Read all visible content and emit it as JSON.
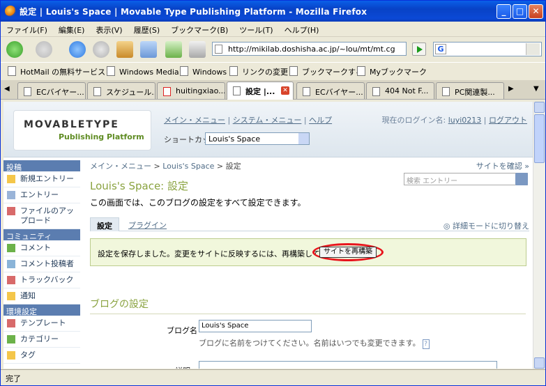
{
  "window": {
    "title": "設定 | Louis's Space | Movable Type Publishing Platform - Mozilla Firefox"
  },
  "menubar": [
    "ファイル(F)",
    "編集(E)",
    "表示(V)",
    "履歴(S)",
    "ブックマーク(B)",
    "ツール(T)",
    "ヘルプ(H)"
  ],
  "navbar": {
    "url": "http://mikilab.doshisha.ac.jp/~lou/mt/mt.cgi?_",
    "search_value": ""
  },
  "bookmarks": [
    "HotMail の無料サービス",
    "Windows Media",
    "Windows",
    "リンクの変更",
    "ブックマークする",
    "Myブックマーク"
  ],
  "tabs": [
    "ECバイヤー...",
    "スケジュール...",
    "huitingxiao...",
    "設定 |...",
    "ECバイヤー...",
    "404 Not F...",
    "PC関連製..."
  ],
  "statusbar": {
    "text": "完了"
  },
  "mt": {
    "logo_main": "MOVABLETYPE",
    "logo_sub": "Publishing Platform",
    "nav": [
      "メイン・メニュー",
      "システム・メニュー",
      "ヘルプ"
    ],
    "login_label": "現在のログイン名:",
    "login_user": "luyi0213",
    "logout": "ログアウト",
    "shortcut_label": "ショートカット:",
    "shortcut_value": "Louis's Space"
  },
  "sidebar": {
    "sections": [
      {
        "title": "投稿",
        "items": [
          "新規エントリー",
          "エントリー",
          "ファイルのアップロード"
        ]
      },
      {
        "title": "コミュニティ",
        "items": [
          "コメント",
          "コメント投稿者",
          "トラックバック",
          "通知"
        ]
      },
      {
        "title": "環境設定",
        "items": [
          "テンプレート",
          "カテゴリー",
          "タグ"
        ]
      }
    ]
  },
  "main": {
    "breadcrumb": [
      "メイン・メニュー",
      "Louis's Space",
      "設定"
    ],
    "view_site": "サイトを確認 »",
    "page_title_blog": "Louis's Space:",
    "page_title": "設定",
    "search_placeholder": "検索 エントリー",
    "description": "この画面では、このブログの設定をすべて設定できます。",
    "tabs": [
      "設定",
      "プラグイン"
    ],
    "detail_mode": "詳細モードに切り替え",
    "message": "設定を保存しました。変更をサイトに反映するには、再構築してください。",
    "rebuild_button": "サイトを再構築",
    "section_title": "ブログの設定",
    "blog_name_label": "ブログ名",
    "blog_name_value": "Louis's Space",
    "blog_name_hint": "ブログに名前をつけてください。名前はいつでも変更できます。",
    "help": "?",
    "description_label": "説明"
  }
}
